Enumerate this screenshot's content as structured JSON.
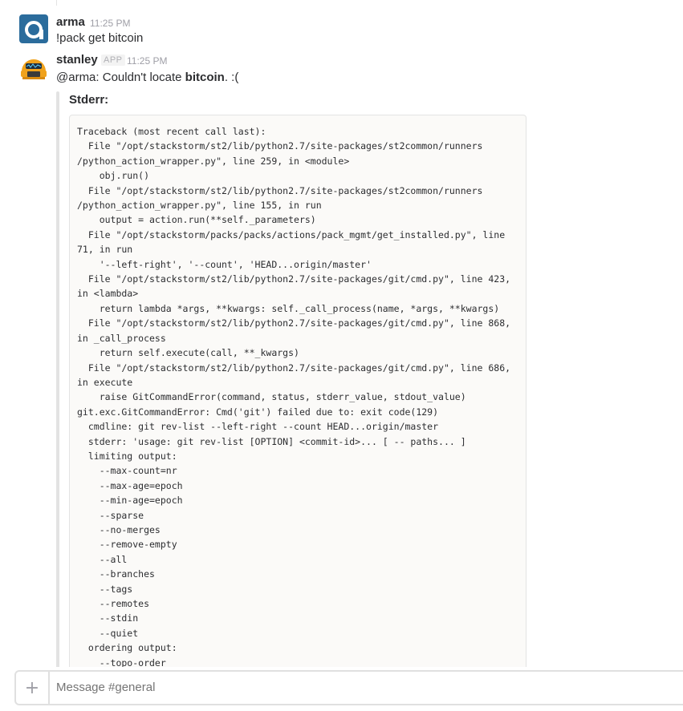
{
  "messages": [
    {
      "username": "arma",
      "time": "11:25 PM",
      "text": "!pack get bitcoin"
    },
    {
      "username": "stanley",
      "badge": "APP",
      "time": "11:25 PM",
      "mention": "@arma",
      "text_before": ": Couldn't locate ",
      "bold": "bitcoin",
      "text_after": ". :(",
      "attachment": {
        "title": "Stderr:",
        "lines": [
          "Traceback (most recent call last):",
          "  File \"/opt/stackstorm/st2/lib/python2.7/site-packages/st2common/runners",
          "/python_action_wrapper.py\", line 259, in <module>",
          "    obj.run()",
          "  File \"/opt/stackstorm/st2/lib/python2.7/site-packages/st2common/runners",
          "/python_action_wrapper.py\", line 155, in run",
          "    output = action.run(**self._parameters)",
          "  File \"/opt/stackstorm/packs/packs/actions/pack_mgmt/get_installed.py\", line",
          "71, in run",
          "    '--left-right', '--count', 'HEAD...origin/master'",
          "  File \"/opt/stackstorm/st2/lib/python2.7/site-packages/git/cmd.py\", line 423,",
          "in <lambda>",
          "    return lambda *args, **kwargs: self._call_process(name, *args, **kwargs)",
          "  File \"/opt/stackstorm/st2/lib/python2.7/site-packages/git/cmd.py\", line 868,",
          "in _call_process",
          "    return self.execute(call, **_kwargs)",
          "  File \"/opt/stackstorm/st2/lib/python2.7/site-packages/git/cmd.py\", line 686,",
          "in execute",
          "    raise GitCommandError(command, status, stderr_value, stdout_value)",
          "git.exc.GitCommandError: Cmd('git') failed due to: exit code(129)",
          "  cmdline: git rev-list --left-right --count HEAD...origin/master",
          "  stderr: 'usage: git rev-list [OPTION] <commit-id>... [ -- paths... ]",
          "  limiting output:",
          "    --max-count=nr",
          "    --max-age=epoch",
          "    --min-age=epoch",
          "    --sparse",
          "    --no-merges",
          "    --remove-empty",
          "    --all",
          "    --branches",
          "    --tags",
          "    --remotes",
          "    --stdin",
          "    --quiet",
          "  ordering output:",
          "    --topo-order"
        ]
      }
    }
  ],
  "composer": {
    "plus": "+",
    "placeholder": "Message #general"
  },
  "colors": {
    "arma_avatar": "#2b6c9c",
    "stanley_avatar": "#f0a21c",
    "code_background": "#fbfaf8"
  },
  "icons": {
    "arma_avatar": "arma-logo-icon",
    "stanley_avatar": "stanley-bot-icon",
    "add": "plus-icon"
  }
}
